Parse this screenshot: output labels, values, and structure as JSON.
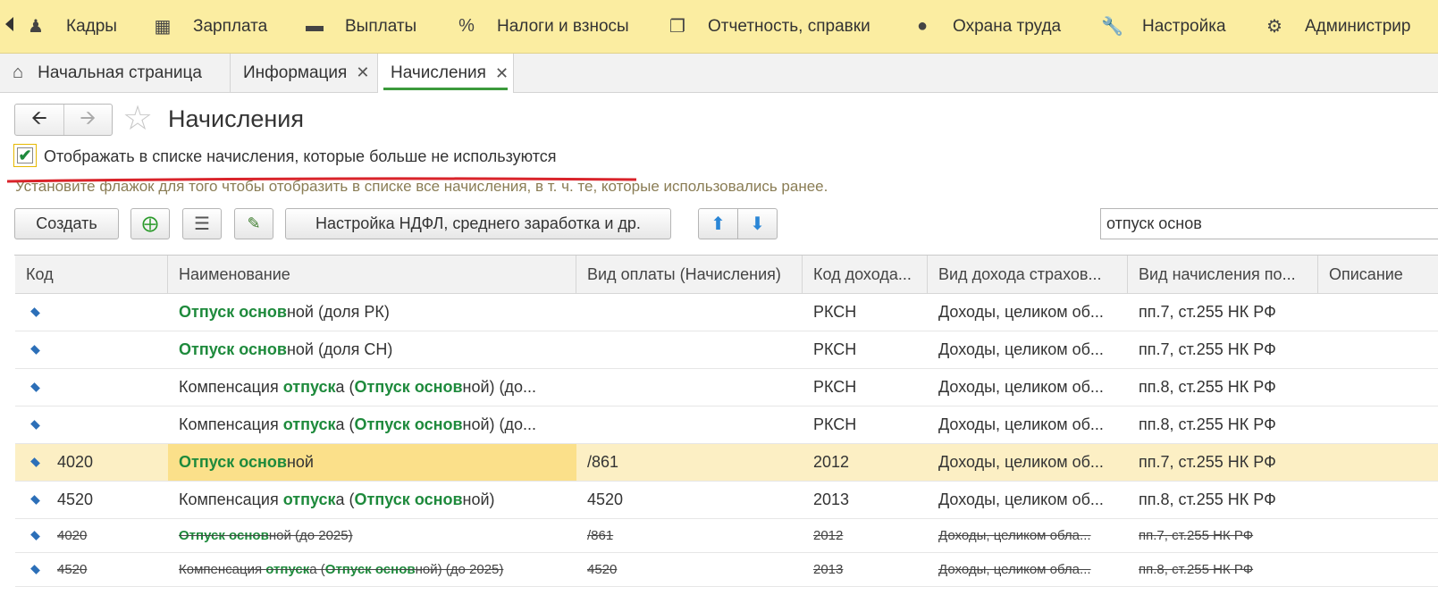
{
  "topnav": {
    "items": [
      {
        "label": "Кадры",
        "icon": "people-icon"
      },
      {
        "label": "Зарплата",
        "icon": "calculator-icon"
      },
      {
        "label": "Выплаты",
        "icon": "wallet-icon"
      },
      {
        "label": "Налоги и взносы",
        "icon": "percent-icon"
      },
      {
        "label": "Отчетность, справки",
        "icon": "documents-icon"
      },
      {
        "label": "Охрана труда",
        "icon": "helmet-icon"
      },
      {
        "label": "Настройка",
        "icon": "wrench-icon"
      },
      {
        "label": "Администрир",
        "icon": "gear-icon"
      }
    ]
  },
  "tabs": [
    {
      "label": "Начальная страница"
    },
    {
      "label": "Информация"
    },
    {
      "label": "Начисления"
    }
  ],
  "page": {
    "title": "Начисления",
    "checkbox_label": "Отображать в списке начисления, которые больше не используются",
    "hint": "Установите флажок для того чтобы отобразить в списке все начисления, в т. ч. те, которые использовались ранее.",
    "checkbox_checked": true
  },
  "toolbar": {
    "create_label": "Создать",
    "ndfl_label": "Настройка НДФЛ, среднего заработка и др."
  },
  "search": {
    "value": "отпуск основ"
  },
  "colors": {
    "accent": "#1e8a3c",
    "topbar": "#fbeda1",
    "selected_row": "#fcefc4",
    "annotation": "#d9232a"
  },
  "table": {
    "headers": [
      "Код",
      "Наименование",
      "Вид оплаты (Начисления)",
      "Код дохода...",
      "Вид дохода страхов...",
      "Вид начисления по...",
      "Описание"
    ],
    "rows": [
      {
        "code": "",
        "name": [
          [
            "Отпуск основ",
            1
          ],
          [
            "ной (доля РК)",
            0
          ]
        ],
        "pay": "",
        "income": "РКСН",
        "ins": "Доходы, целиком об...",
        "kind": "пп.7, ст.255 НК РФ",
        "old": false,
        "selected": false
      },
      {
        "code": "",
        "name": [
          [
            "Отпуск основ",
            1
          ],
          [
            "ной (доля СН)",
            0
          ]
        ],
        "pay": "",
        "income": "РКСН",
        "ins": "Доходы, целиком об...",
        "kind": "пп.7, ст.255 НК РФ",
        "old": false,
        "selected": false
      },
      {
        "code": "",
        "name": [
          [
            "Компенсация ",
            0
          ],
          [
            "отпуск",
            1
          ],
          [
            "а (",
            0
          ],
          [
            "Отпуск основ",
            1
          ],
          [
            "ной) (до...",
            0
          ]
        ],
        "pay": "",
        "income": "РКСН",
        "ins": "Доходы, целиком об...",
        "kind": "пп.8, ст.255 НК РФ",
        "old": false,
        "selected": false
      },
      {
        "code": "",
        "name": [
          [
            "Компенсация ",
            0
          ],
          [
            "отпуск",
            1
          ],
          [
            "а (",
            0
          ],
          [
            "Отпуск основ",
            1
          ],
          [
            "ной) (до...",
            0
          ]
        ],
        "pay": "",
        "income": "РКСН",
        "ins": "Доходы, целиком об...",
        "kind": "пп.8, ст.255 НК РФ",
        "old": false,
        "selected": false
      },
      {
        "code": "4020",
        "name": [
          [
            "Отпуск основ",
            1
          ],
          [
            "ной",
            0
          ]
        ],
        "pay": "/861",
        "income": "2012",
        "ins": "Доходы, целиком об...",
        "kind": "пп.7, ст.255 НК РФ",
        "old": false,
        "selected": true
      },
      {
        "code": "4520",
        "name": [
          [
            "Компенсация ",
            0
          ],
          [
            "отпуск",
            1
          ],
          [
            "а (",
            0
          ],
          [
            "Отпуск основ",
            1
          ],
          [
            "ной)",
            0
          ]
        ],
        "pay": "4520",
        "income": "2013",
        "ins": "Доходы, целиком об...",
        "kind": "пп.8, ст.255 НК РФ",
        "old": false,
        "selected": false
      },
      {
        "code": "4020",
        "name": [
          [
            "Отпуск основ",
            1
          ],
          [
            "ной (до 2025)",
            0
          ]
        ],
        "pay": "/861",
        "income": "2012",
        "ins": "Доходы, целиком обла...",
        "kind": "пп.7, ст.255 НК РФ",
        "old": true,
        "selected": false
      },
      {
        "code": "4520",
        "name": [
          [
            "Компенсация ",
            0
          ],
          [
            "отпуск",
            1
          ],
          [
            "а (",
            0
          ],
          [
            "Отпуск основ",
            1
          ],
          [
            "ной) (до 2025)",
            0
          ]
        ],
        "pay": "4520",
        "income": "2013",
        "ins": "Доходы, целиком обла...",
        "kind": "пп.8, ст.255 НК РФ",
        "old": true,
        "selected": false
      }
    ]
  }
}
